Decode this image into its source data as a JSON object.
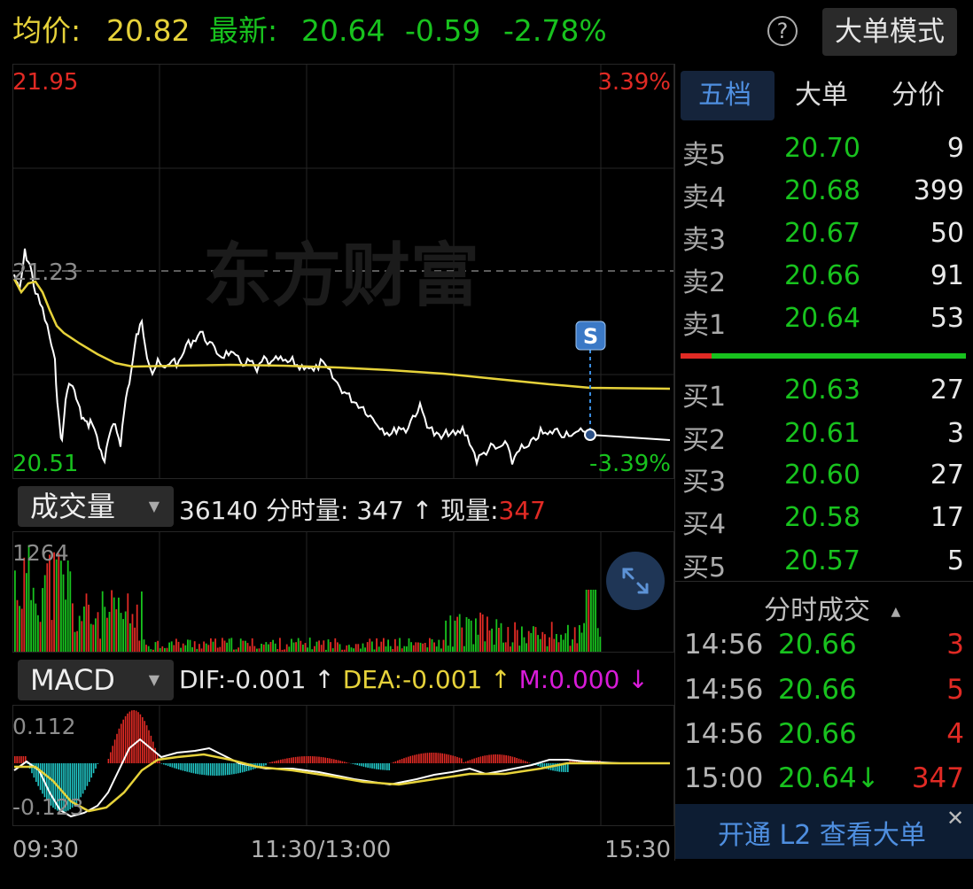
{
  "header": {
    "avg_label": "均价:",
    "avg_value": "20.82",
    "latest_label": "最新:",
    "latest_value": "20.64",
    "change": "-0.59",
    "change_pct": "-2.78%",
    "help_icon": "?",
    "mode_button": "大单模式"
  },
  "price_chart": {
    "high_price": "21.95",
    "high_pct": "3.39%",
    "low_price": "20.51",
    "low_pct": "-3.39%",
    "prev_close": "21.23",
    "watermark": "东方财富",
    "signal_badge": "S",
    "colors": {
      "price_line": "#ffffff",
      "avg_line": "#e6d23a",
      "up": "#e02a24",
      "down": "#18c21e"
    }
  },
  "volume": {
    "selector_label": "成交量",
    "total": "36140",
    "period_label": "分时量:",
    "period_value": "347",
    "arrow_up": "↑",
    "current_label": "现量:",
    "current_value": "347",
    "max_label": "1264"
  },
  "macd": {
    "selector_label": "MACD",
    "dif_label": "DIF:",
    "dif_value": "-0.001",
    "dif_arrow": "↑",
    "dea_label": "DEA:",
    "dea_value": "-0.001",
    "dea_arrow": "↑",
    "m_label": "M:",
    "m_value": "0.000",
    "m_arrow": "↓",
    "top_value": "0.112",
    "bottom_value": "-0.123"
  },
  "time_axis": {
    "start": "09:30",
    "mid": "11:30/13:00",
    "end": "15:30"
  },
  "order_book": {
    "tabs": [
      {
        "label": "五档",
        "active": true
      },
      {
        "label": "大单",
        "active": false
      },
      {
        "label": "分价",
        "active": false
      }
    ],
    "sells": [
      {
        "label": "卖5",
        "price": "20.70",
        "volume": "9"
      },
      {
        "label": "卖4",
        "price": "20.68",
        "volume": "399"
      },
      {
        "label": "卖3",
        "price": "20.67",
        "volume": "50"
      },
      {
        "label": "卖2",
        "price": "20.66",
        "volume": "91"
      },
      {
        "label": "卖1",
        "price": "20.64",
        "volume": "53"
      }
    ],
    "buys": [
      {
        "label": "买1",
        "price": "20.63",
        "volume": "27"
      },
      {
        "label": "买2",
        "price": "20.61",
        "volume": "3"
      },
      {
        "label": "买3",
        "price": "20.60",
        "volume": "27"
      },
      {
        "label": "买4",
        "price": "20.58",
        "volume": "17"
      },
      {
        "label": "买5",
        "price": "20.57",
        "volume": "5"
      }
    ],
    "ratio_bar": {
      "sell_fraction": 0.11
    }
  },
  "trades": {
    "title": "分时成交",
    "collapse_icon": "▲",
    "rows": [
      {
        "time": "14:56",
        "price": "20.66",
        "volume": "3"
      },
      {
        "time": "14:56",
        "price": "20.66",
        "volume": "5"
      },
      {
        "time": "14:56",
        "price": "20.66",
        "volume": "4"
      },
      {
        "time": "15:00",
        "price": "20.64↓",
        "volume": "347"
      }
    ]
  },
  "banner": {
    "text": "开通 L2 查看大单",
    "close_icon": "✕"
  }
}
